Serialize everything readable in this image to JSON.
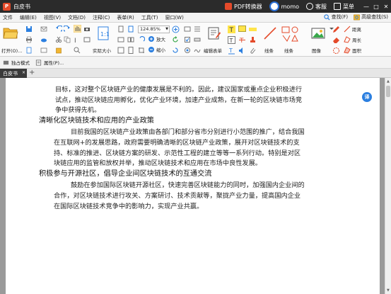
{
  "titlebar": {
    "app_name": "白皮书",
    "pdf_converter": "PDF转换器",
    "momo": "momo",
    "service": "客服",
    "menu": "菜单",
    "win_min": "—",
    "win_max": "□",
    "win_close": "✕"
  },
  "menubar": {
    "items": [
      "文件",
      "编辑(E)",
      "视图(V)",
      "文档(D)",
      "注释(C)",
      "表单(R)",
      "工具(T)",
      "窗口(W)"
    ],
    "find": "查找(F)",
    "advanced_find": "高级查找(S)"
  },
  "ribbon": {
    "open": "打开(O)...",
    "actual_size": "实际大小",
    "zoom_value": "124.85%",
    "zoom_in": "放大",
    "zoom_out": "缩小",
    "edit_form": "编辑表单",
    "line": "线条",
    "shape": "线条",
    "image": "图像",
    "distance": "距离",
    "perimeter": "周长",
    "area": "面积"
  },
  "subbar": {
    "standalone_mode": "独占模式",
    "properties": "属性(P)..."
  },
  "tabs": {
    "active_tab": "白皮书",
    "close": "×",
    "add": "+"
  },
  "document": {
    "line1": "目标，这对整个区块链产业的健康发展是不利的。因此，建议国家或重点企业积极进行",
    "line2": "试点，推动区块链应用孵化，优化产业环境，加速产业成熟，在新一轮的区块链市场竞",
    "line3": "争中获得先机。",
    "heading1": "清晰化区块链技术和应用的产业政策",
    "line4": "目前我国的区块链产业政策由各部门和部分省市分别进行小范围的推广，结合我国",
    "line5": "在互联网+的发展思路，政府需要明确清晰的区块链产业政策，展开对区块链技术的支",
    "line6": "持、标准的推进、区块链方案的研发、示范性工程的建立等等一系列行动。特别是对区",
    "line7": "块链应用的监管和放权并举，推动区块链技术和应用在市场中良性发展。",
    "heading2": "积极参与开源社区，倡导企业间区块链技术的互通交流",
    "line8": "鼓励在参加国际区块链开源社区，快速完善区块链能力的同时，加强国内企业间的",
    "line9": "合作，对区块链技术进行攻关、方案研讨、技术贡献等，聚拢产业力量，提高国内企业",
    "line10": "在国际区块链技术竞争中的影响力，实现产业共赢。"
  },
  "float_button": "译",
  "colors": {
    "titlebar": "#2b2b2b",
    "accent_blue": "#2b7fe0",
    "brand_red": "#e44a2a",
    "folder_yellow": "#f2b632"
  }
}
